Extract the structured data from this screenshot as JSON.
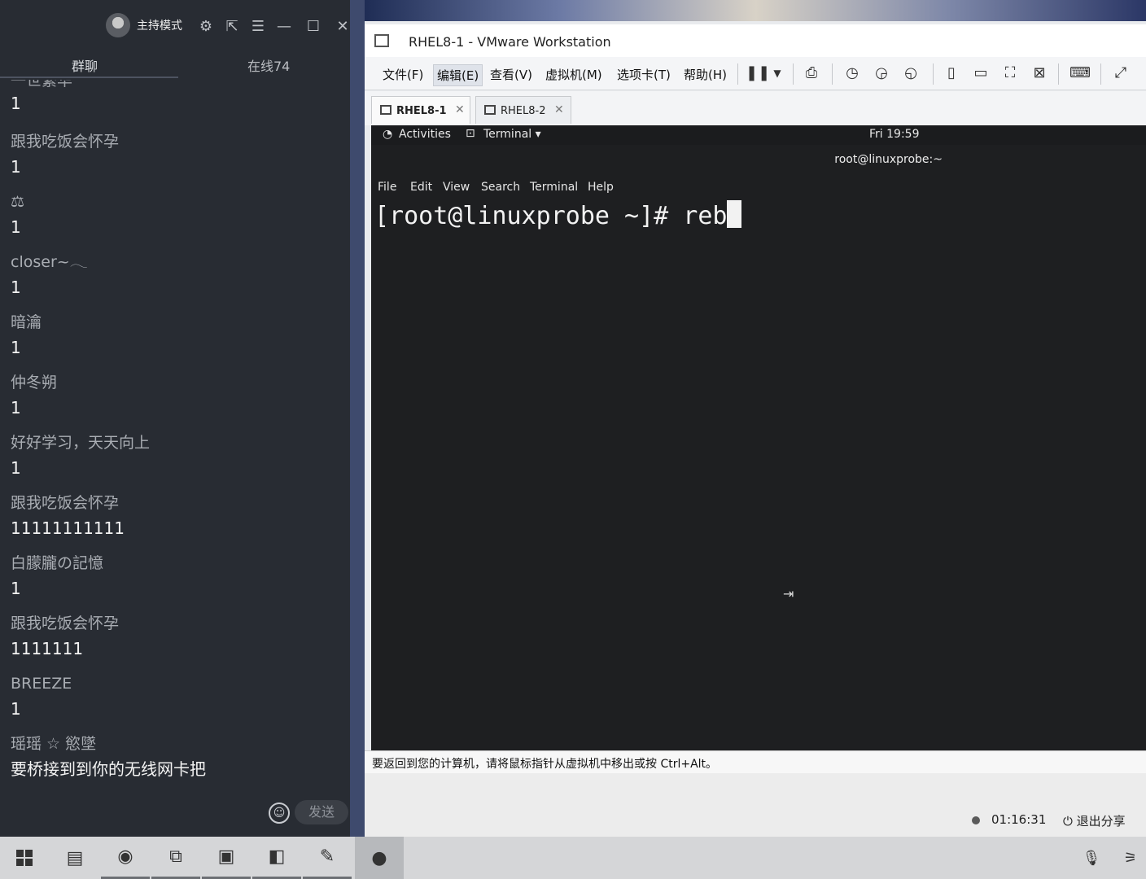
{
  "chat": {
    "host_label": "主持模式",
    "tabs": [
      "群聊",
      "在线74"
    ],
    "partial_top": "一世繁华",
    "messages": [
      {
        "sender": "",
        "content": "1"
      },
      {
        "sender": "跟我吃饭会怀孕",
        "content": "1"
      },
      {
        "sender": "⚖",
        "content": "1"
      },
      {
        "sender": "closer~𓂃",
        "content": "1"
      },
      {
        "sender": "暗瀹",
        "content": "1"
      },
      {
        "sender": "仲冬朔",
        "content": "1"
      },
      {
        "sender": "好好学习，天天向上",
        "content": "1"
      },
      {
        "sender": "跟我吃饭会怀孕",
        "content": "11111111111"
      },
      {
        "sender": "白朦朧の記憶",
        "content": "1"
      },
      {
        "sender": "跟我吃饭会怀孕",
        "content": "1111111"
      },
      {
        "sender": "BREEZE",
        "content": "1"
      },
      {
        "sender": "瑶瑶 ☆ 慾墜",
        "content": "要桥接到到你的无线网卡把"
      }
    ],
    "send_label": "发送"
  },
  "vmware": {
    "title": "RHEL8-1 - VMware Workstation",
    "menus": [
      "文件(F)",
      "编辑(E)",
      "查看(V)",
      "虚拟机(M)",
      "选项卡(T)",
      "帮助(H)"
    ],
    "tabs": [
      "RHEL8-1",
      "RHEL8-2"
    ],
    "hint": "要返回到您的计算机，请将鼠标指针从虚拟机中移出或按 Ctrl+Alt。"
  },
  "guest": {
    "activities": "Activities",
    "app_menu": "Terminal ▾",
    "clock": "Fri 19:59",
    "terminal_title": "root@linuxprobe:~",
    "terminal_menu": [
      "File",
      "Edit",
      "View",
      "Search",
      "Terminal",
      "Help"
    ],
    "prompt": "[root@linuxprobe ~]# reb"
  },
  "share": {
    "timer": "01:16:31",
    "quit_label": "退出分享"
  }
}
